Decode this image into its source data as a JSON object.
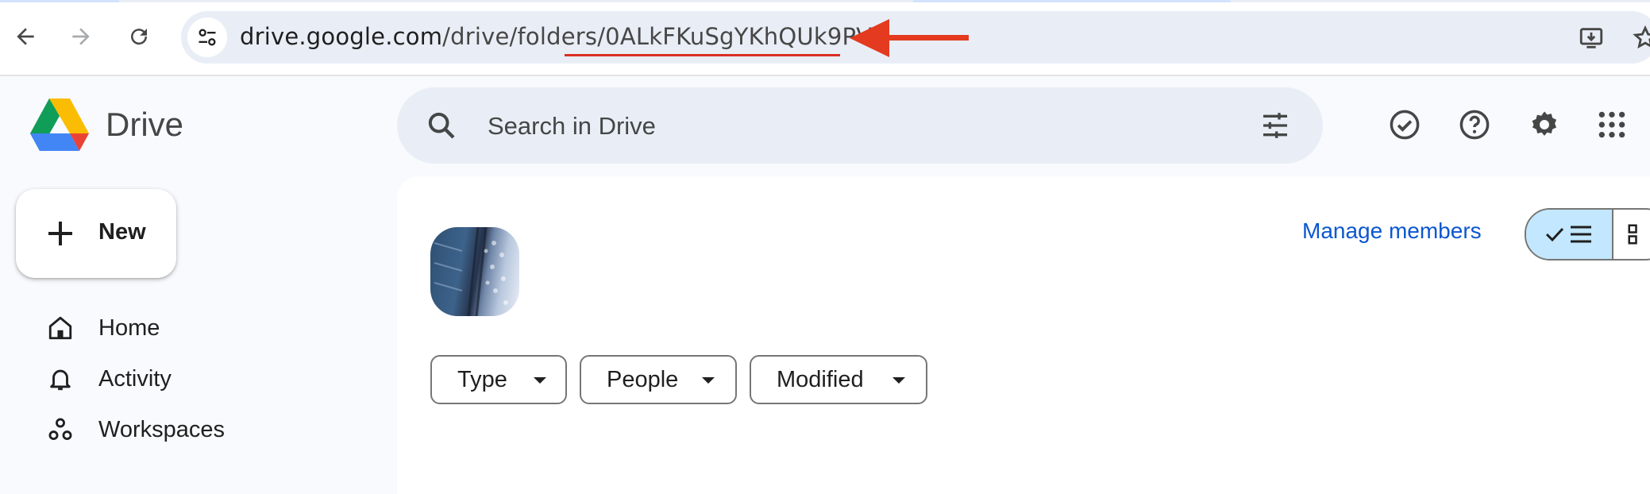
{
  "browser": {
    "url_host": "drive.google.com",
    "url_path": "/drive/folders/",
    "url_folder_id": "0ALkFKuSgYKhQUk9PVA",
    "annotation_color": "#d93025"
  },
  "header": {
    "app_title": "Drive",
    "search_placeholder": "Search in Drive"
  },
  "sidebar": {
    "new_label": "New",
    "items": [
      {
        "label": "Home",
        "icon": "home-icon"
      },
      {
        "label": "Activity",
        "icon": "bell-icon"
      },
      {
        "label": "Workspaces",
        "icon": "workspaces-icon"
      }
    ]
  },
  "main": {
    "manage_members": "Manage members",
    "filters": [
      "Type",
      "People",
      "Modified"
    ],
    "view_mode": "list"
  },
  "colors": {
    "accent": "#0b57d0",
    "selected_toggle": "#c2e7ff",
    "search_bg": "#e9eef6",
    "page_bg": "#f8fafd"
  }
}
